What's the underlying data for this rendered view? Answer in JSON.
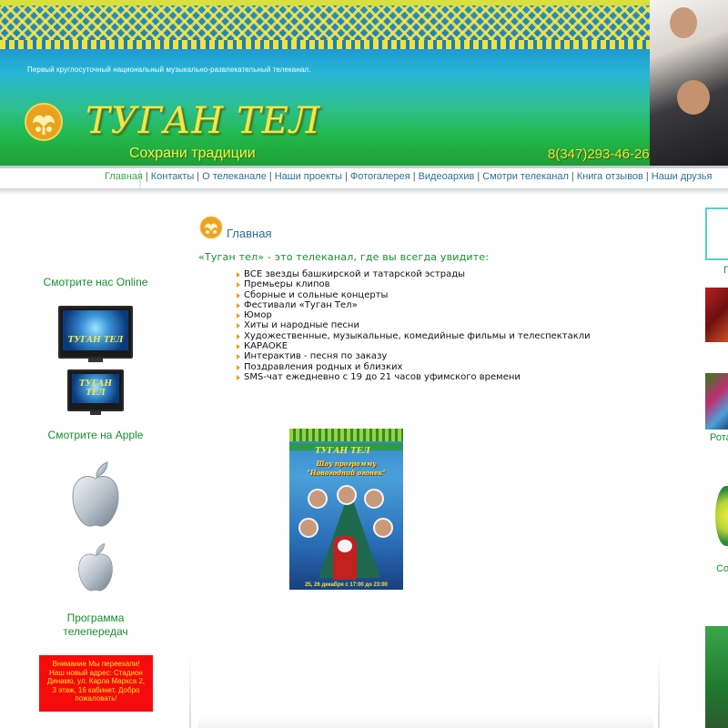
{
  "header": {
    "tagline": "Первый круглосуточный национальный музыкально-развлекательный  телеканал.",
    "logo_title": "ТУГАН ТЕЛ",
    "logo_subtitle": "Сохрани традиции",
    "phone": "8(347)293-46-26"
  },
  "nav": {
    "items": [
      {
        "label": "Главная",
        "active": true
      },
      {
        "label": "Контакты"
      },
      {
        "label": "О телеканале"
      },
      {
        "label": "Наши проекты"
      },
      {
        "label": "Фотогалерея"
      },
      {
        "label": "Видеоархив"
      },
      {
        "label": "Смотри телеканал"
      },
      {
        "label": "Книга отзывов"
      },
      {
        "label": "Наши друзья"
      }
    ],
    "separator": "|"
  },
  "left": {
    "online_link": "Смотрите нас Online",
    "tv_logo_text": "ТУГАН ТЕЛ",
    "apple_link": "Смотрите на Apple",
    "program_link_line1": "Программа",
    "program_link_line2": "телепередач",
    "notice": "Внимание Мы переехали! Наш новый адрес: Стадион Динамо, ул. Карла Маркса 2, 3 этаж, 16 кабинет. Добро пожаловать!"
  },
  "main": {
    "heading": "Главная",
    "intro": "«Туган тел» - это телеканал, где вы всегда увидите:",
    "features": [
      "ВСЕ   звезды башкирской и татарской эстрады",
      "Премьеры клипов",
      "Сборные и сольные концерты",
      "Фестивали «Туган Тел»",
      "Юмор",
      "Хиты и народные песни",
      "Художественные, музыкальные, комедийные фильмы и телеспектакли",
      "КАРАОКЕ",
      "Интерактив - песня по заказу",
      "Поздравления родных и близких",
      "SMS-чат ежедневно с 19 до 21 часов уфимского времени"
    ],
    "poster": {
      "logo": "ТУГАН ТЕЛ",
      "title_line1": "Шоу программу",
      "title_line2": "\"Новогодний огонек\"",
      "date": "25, 26 декабря с 17:00 до 23:00"
    }
  },
  "right": {
    "text1": "П",
    "text2": "Рота",
    "text3": "Со"
  },
  "colors": {
    "nav_link": "#2f6f98",
    "nav_active": "#3aa64a",
    "green_text": "#178f2d",
    "notice_bg": "#f50b0b",
    "notice_text": "#f5e12b",
    "logo_yellow": "#f3e64a"
  }
}
